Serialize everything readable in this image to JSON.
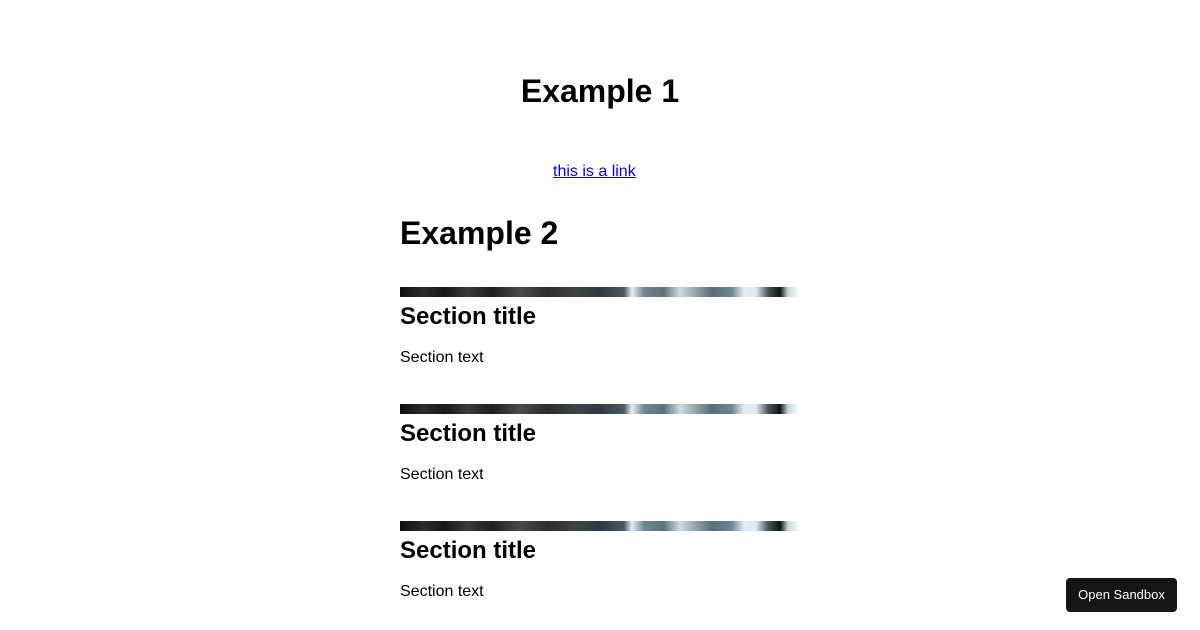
{
  "example1": {
    "title": "Example 1",
    "link_text": "this is a link"
  },
  "example2": {
    "title": "Example 2",
    "sections": [
      {
        "title": "Section title",
        "text": "Section text"
      },
      {
        "title": "Section title",
        "text": "Section text"
      },
      {
        "title": "Section title",
        "text": "Section text"
      }
    ]
  },
  "sandbox": {
    "button_label": "Open Sandbox"
  },
  "colors": {
    "link": "#0000ee",
    "button_bg": "#151515",
    "button_text": "#ffffff"
  }
}
